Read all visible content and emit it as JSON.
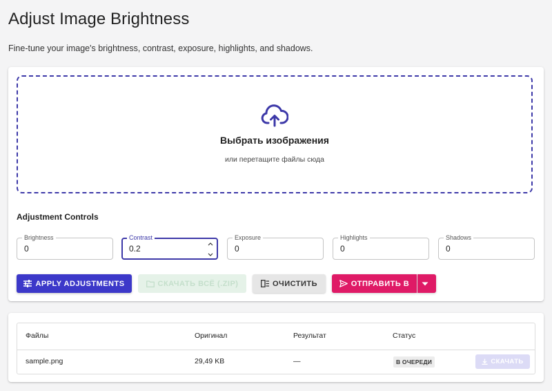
{
  "page": {
    "title": "Adjust Image Brightness",
    "subtitle": "Fine-tune your image's brightness, contrast, exposure, highlights, and shadows."
  },
  "dropzone": {
    "title": "Выбрать изображения",
    "hint": "или перетащите файлы сюда",
    "icon": "cloud-upload-icon"
  },
  "controls": {
    "section_title": "Adjustment Controls",
    "fields": [
      {
        "label": "Brightness",
        "value": "0"
      },
      {
        "label": "Contrast",
        "value": "0.2",
        "focused": true
      },
      {
        "label": "Exposure",
        "value": "0"
      },
      {
        "label": "Highlights",
        "value": "0"
      },
      {
        "label": "Shadows",
        "value": "0"
      }
    ]
  },
  "actions": {
    "apply_label": "APPLY ADJUSTMENTS",
    "zip_label": "СКАЧАТЬ ВСЁ (.ZIP)",
    "clear_label": "ОЧИСТИТЬ",
    "send_label": "ОТПРАВИТЬ В"
  },
  "table": {
    "headers": [
      "Файлы",
      "Оригинал",
      "Результат",
      "Статус"
    ],
    "rows": [
      {
        "file": "sample.png",
        "original": "29,49 KB",
        "result": "—",
        "status": "В ОЧЕРЕДИ",
        "download_label": "СКАЧАТЬ"
      }
    ]
  },
  "colors": {
    "primary": "#3c38c9",
    "accent": "#df1a66",
    "background": "#f4f4f5"
  }
}
